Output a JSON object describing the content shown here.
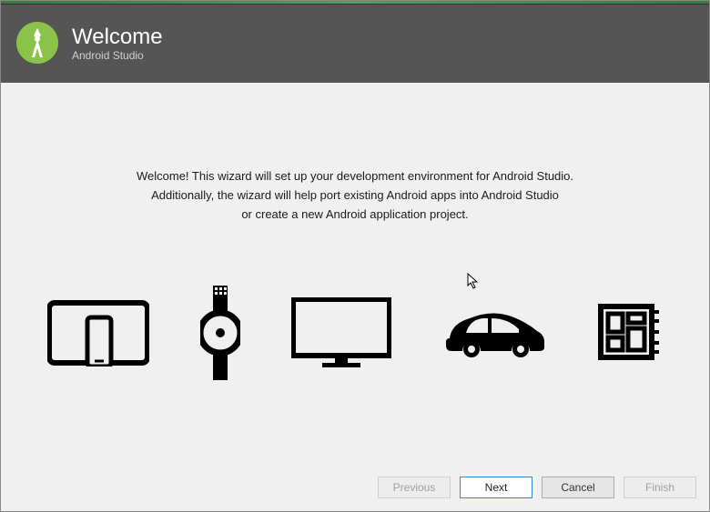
{
  "header": {
    "title": "Welcome",
    "subtitle": "Android Studio"
  },
  "description": {
    "line1": "Welcome! This wizard will set up your development environment for Android Studio.",
    "line2": "Additionally, the wizard will help port existing Android apps into Android Studio",
    "line3": "or create a new Android application project."
  },
  "buttons": {
    "previous": "Previous",
    "next": "Next",
    "cancel": "Cancel",
    "finish": "Finish"
  }
}
